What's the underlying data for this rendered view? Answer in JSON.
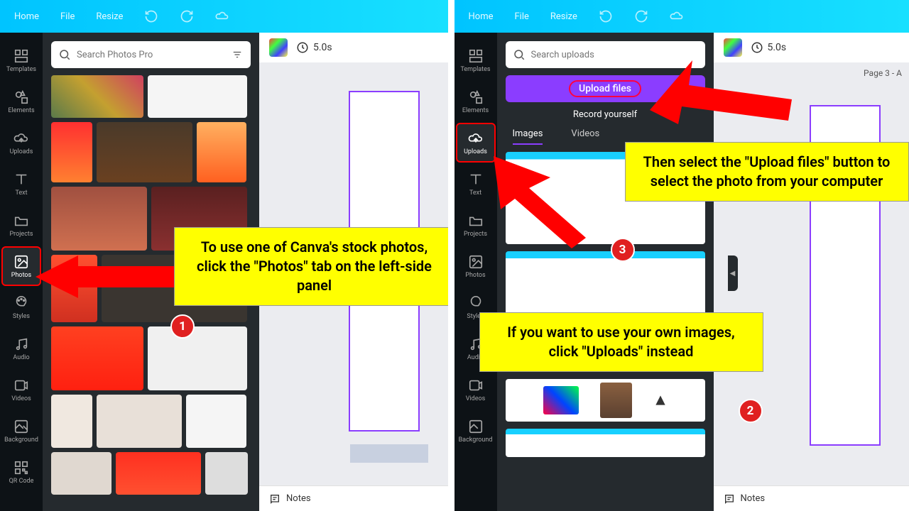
{
  "topbar": {
    "home": "Home",
    "file": "File",
    "resize": "Resize"
  },
  "sidebar": {
    "templates": "Templates",
    "elements": "Elements",
    "uploads": "Uploads",
    "text": "Text",
    "projects": "Projects",
    "photos": "Photos",
    "styles": "Styles",
    "audio": "Audio",
    "videos": "Videos",
    "background": "Background",
    "qrcode": "QR Code"
  },
  "search": {
    "photos_placeholder": "Search Photos Pro",
    "uploads_placeholder": "Search uploads"
  },
  "uploads_panel": {
    "upload_files": "Upload files",
    "record_yourself": "Record yourself",
    "tab_images": "Images",
    "tab_videos": "Videos"
  },
  "canvas": {
    "duration": "5.0s",
    "page_label": "Page 3 - A",
    "notes": "Notes"
  },
  "callouts": {
    "c1": "To use one of Canva's stock photos, click the \"Photos\" tab on the left-side panel",
    "c2": "If you want to use your own images, click \"Uploads\" instead",
    "c3": "Then select the \"Upload files\" button to select the photo from your computer",
    "b1": "1",
    "b2": "2",
    "b3": "3"
  }
}
